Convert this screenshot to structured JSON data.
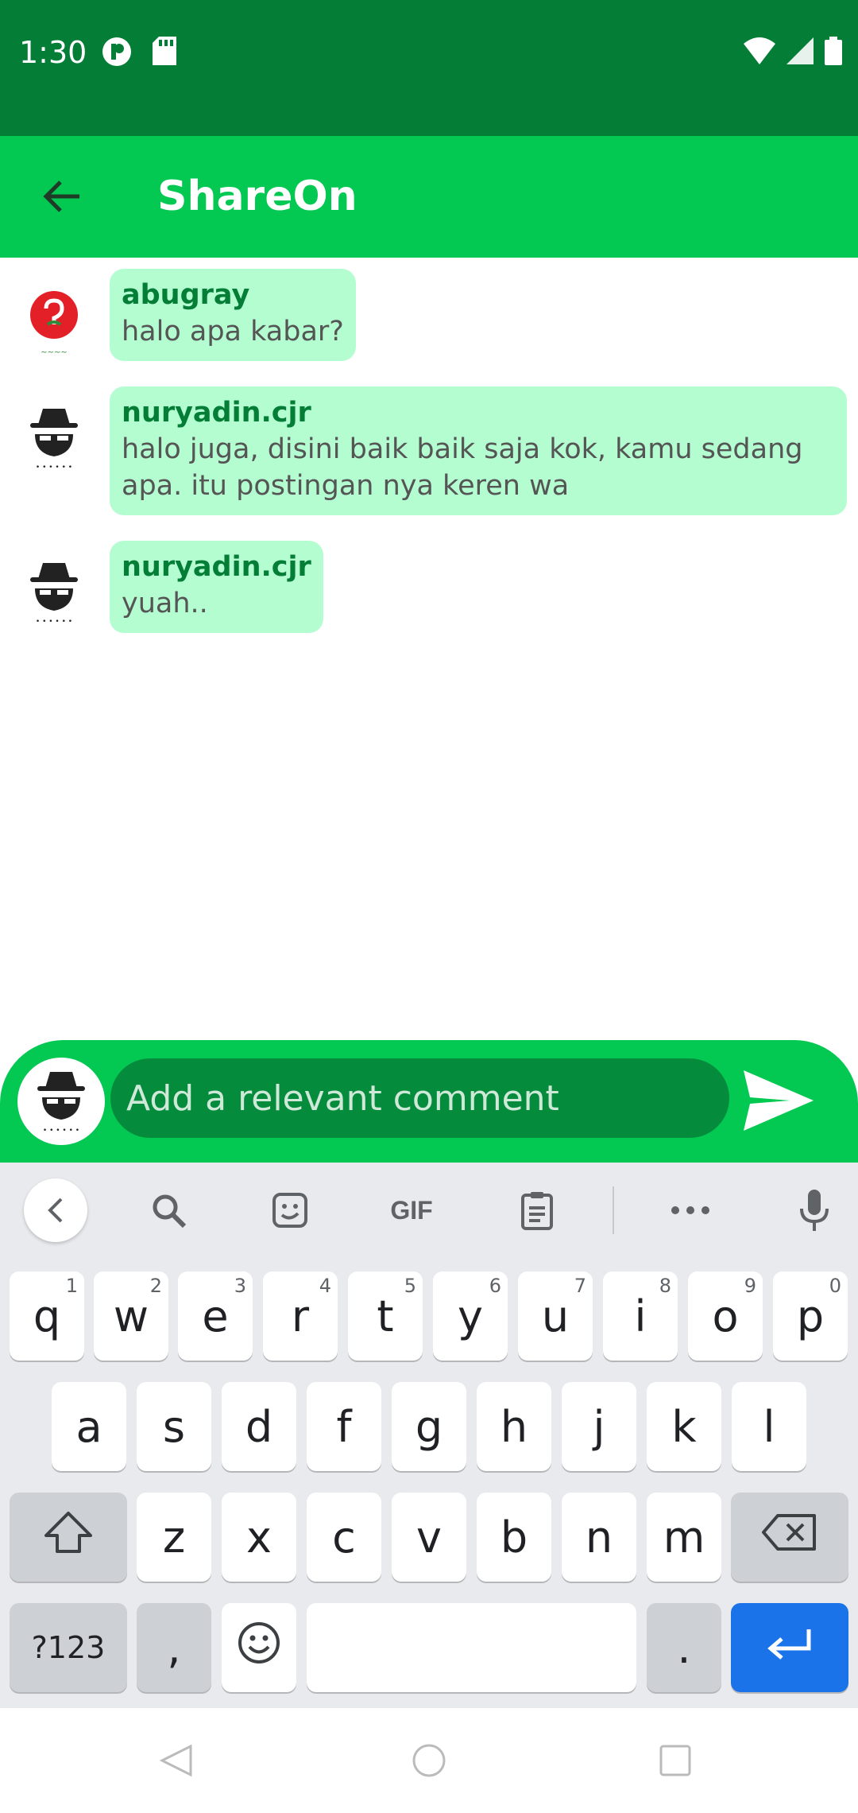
{
  "status_bar": {
    "time": "1:30",
    "icons": [
      "p-icon",
      "sd-card-icon"
    ],
    "right_icons": [
      "wifi-icon",
      "signal-icon",
      "battery-icon"
    ]
  },
  "app_bar": {
    "title": "ShareOn",
    "back_icon": "arrow-back-icon"
  },
  "messages": [
    {
      "user": "abugray",
      "text": "halo apa kabar?",
      "avatar": "logo-avatar"
    },
    {
      "user": "nuryadin.cjr",
      "text": "halo juga, disini baik baik saja kok, kamu sedang apa. itu postingan nya keren wa",
      "avatar": "incognito-avatar"
    },
    {
      "user": "nuryadin.cjr",
      "text": "yuah..",
      "avatar": "incognito-avatar"
    }
  ],
  "comment": {
    "placeholder": "Add a relevant comment",
    "send_icon": "send-icon"
  },
  "keyboard": {
    "toolbar": [
      "chevron-left-icon",
      "search-icon",
      "sticker-icon",
      "GIF",
      "clipboard-icon",
      "more-icon",
      "mic-icon"
    ],
    "gif_label": "GIF",
    "row1": [
      {
        "k": "q",
        "h": "1"
      },
      {
        "k": "w",
        "h": "2"
      },
      {
        "k": "e",
        "h": "3"
      },
      {
        "k": "r",
        "h": "4"
      },
      {
        "k": "t",
        "h": "5"
      },
      {
        "k": "y",
        "h": "6"
      },
      {
        "k": "u",
        "h": "7"
      },
      {
        "k": "i",
        "h": "8"
      },
      {
        "k": "o",
        "h": "9"
      },
      {
        "k": "p",
        "h": "0"
      }
    ],
    "row2": [
      "a",
      "s",
      "d",
      "f",
      "g",
      "h",
      "j",
      "k",
      "l"
    ],
    "row3": [
      "z",
      "x",
      "c",
      "v",
      "b",
      "n",
      "m"
    ],
    "symbols_label": "?123",
    "comma": ",",
    "period": "."
  }
}
